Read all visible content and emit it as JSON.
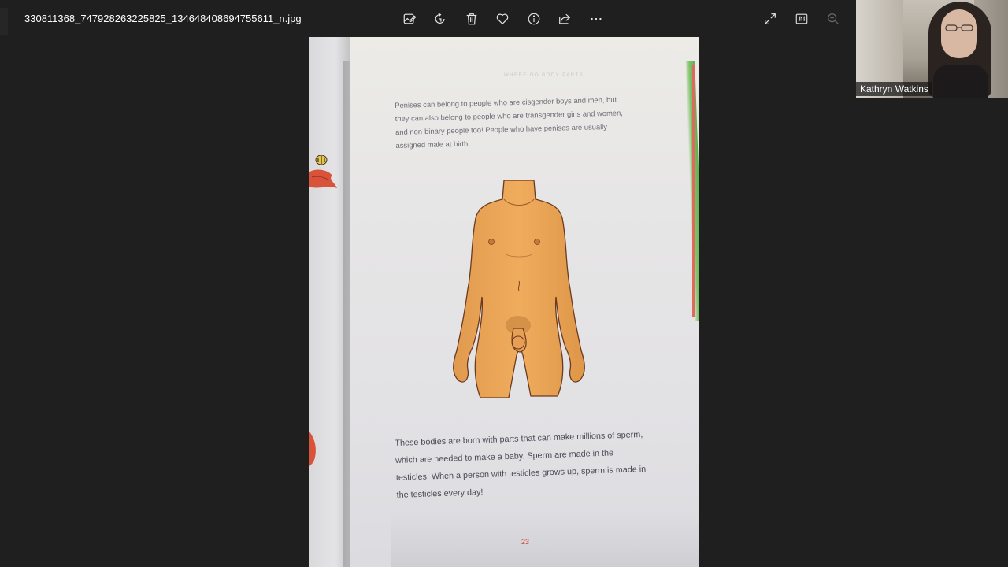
{
  "window": {
    "filename": "330811368_747928263225825_134648408694755611_n.jpg"
  },
  "toolbar": {
    "buttons": [
      {
        "name": "edit-image-button",
        "icon": "edit-image-icon"
      },
      {
        "name": "rotate-button",
        "icon": "rotate-icon"
      },
      {
        "name": "delete-button",
        "icon": "delete-icon"
      },
      {
        "name": "favorite-button",
        "icon": "heart-icon"
      },
      {
        "name": "file-info-button",
        "icon": "info-icon"
      },
      {
        "name": "share-button",
        "icon": "share-icon"
      },
      {
        "name": "more-options-button",
        "icon": "more-icon"
      }
    ],
    "right_buttons": [
      {
        "name": "full-screen-button",
        "icon": "expand-icon"
      },
      {
        "name": "actual-size-button",
        "icon": "actual-size-icon"
      },
      {
        "name": "zoom-out-button",
        "icon": "zoom-out-icon"
      }
    ]
  },
  "book_page": {
    "running_head": "WHERE DO BODY PARTS",
    "paragraph_1": "Penises can belong to people who are cisgender boys and men, but they can also belong to people who are transgender girls and women, and non-binary people too! People who have penises are usually assigned male at birth.",
    "paragraph_2": "These bodies are born with parts that can make millions of sperm, which are needed to make a baby. Sperm are made in the testicles. When a person with testicles grows up, sperm is made in the testicles every day!",
    "page_number": "23"
  },
  "video": {
    "participant_name": "Kathryn Watkins"
  },
  "colors": {
    "background": "#1f1f1f",
    "icon": "#e6e6e6",
    "icon_disabled": "#6b6b6b",
    "page_number": "#d4432f",
    "page_edge_green": "#5fb04f"
  }
}
